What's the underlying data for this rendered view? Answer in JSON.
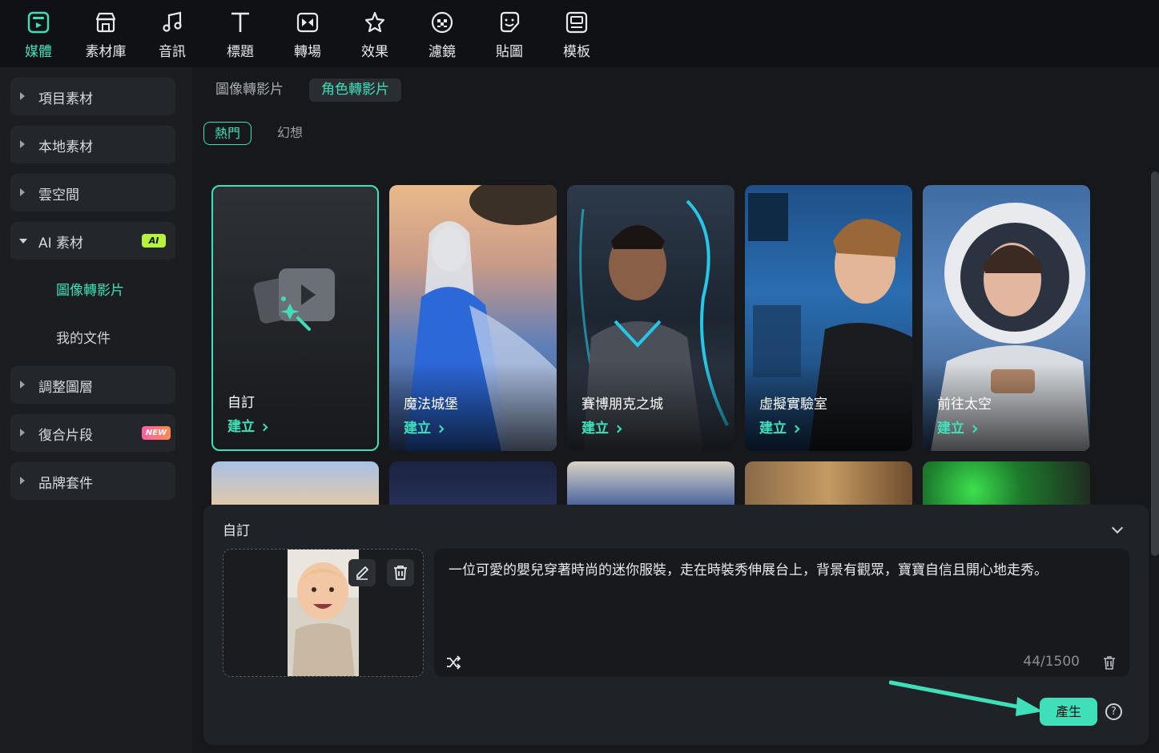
{
  "toolbar": {
    "items": [
      {
        "label": "媒體",
        "icon": "media-icon"
      },
      {
        "label": "素材庫",
        "icon": "store-icon"
      },
      {
        "label": "音訊",
        "icon": "music-icon"
      },
      {
        "label": "標題",
        "icon": "title-icon"
      },
      {
        "label": "轉場",
        "icon": "transition-icon"
      },
      {
        "label": "效果",
        "icon": "effects-icon"
      },
      {
        "label": "濾鏡",
        "icon": "filter-icon"
      },
      {
        "label": "貼圖",
        "icon": "sticker-icon"
      },
      {
        "label": "模板",
        "icon": "template-icon"
      }
    ],
    "active_index": 0,
    "accent_color": "#3fe0b9"
  },
  "sidebar": {
    "items": [
      {
        "label": "項目素材"
      },
      {
        "label": "本地素材"
      },
      {
        "label": "雲空間"
      },
      {
        "label": "AI 素材",
        "badge": "AI"
      },
      {
        "label": "調整圖層"
      },
      {
        "label": "復合片段",
        "badge": "NEW"
      },
      {
        "label": "品牌套件"
      }
    ],
    "sub_items": [
      {
        "label": "圖像轉影片",
        "active": true
      },
      {
        "label": "我的文件"
      }
    ]
  },
  "tabs": [
    {
      "label": "圖像轉影片"
    },
    {
      "label": "角色轉影片",
      "active": true
    }
  ],
  "chips": [
    {
      "label": "熱門",
      "active": true
    },
    {
      "label": "幻想"
    }
  ],
  "cards": [
    {
      "name": "自訂",
      "create": "建立"
    },
    {
      "name": "魔法城堡",
      "create": "建立"
    },
    {
      "name": "賽博朋克之城",
      "create": "建立"
    },
    {
      "name": "虛擬實驗室",
      "create": "建立"
    },
    {
      "name": "前往太空",
      "create": "建立"
    }
  ],
  "panel": {
    "title": "自訂",
    "prompt": "一位可愛的嬰兒穿著時尚的迷你服裝，走在時裝秀伸展台上，背景有觀眾，寶寶自信且開心地走秀。",
    "counter": "44/1500",
    "generate_label": "產生",
    "help_label": "?"
  }
}
